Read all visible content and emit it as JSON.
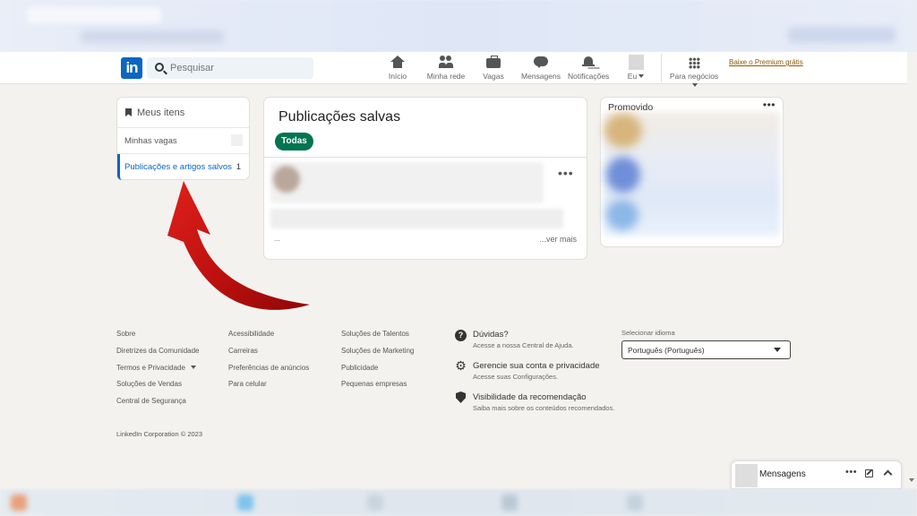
{
  "header": {
    "logo_text": "in",
    "search_placeholder": "Pesquisar",
    "nav": [
      {
        "label": "Início",
        "icon": "home-icon"
      },
      {
        "label": "Minha rede",
        "icon": "network-icon"
      },
      {
        "label": "Vagas",
        "icon": "jobs-icon"
      },
      {
        "label": "Mensagens",
        "icon": "messages-icon"
      },
      {
        "label": "Notificações",
        "icon": "bell-icon"
      },
      {
        "label": "Eu",
        "icon": "avatar"
      },
      {
        "label": "Para negócios",
        "icon": "grid-icon"
      }
    ],
    "premium_link": "Baixe o Premium grátis"
  },
  "left_panel": {
    "title": "Meus itens",
    "items": [
      {
        "label": "Minhas vagas",
        "count": ""
      },
      {
        "label": "Publicações e artigos salvos",
        "count": "1"
      }
    ]
  },
  "center": {
    "title": "Publicações salvas",
    "filter_pill": "Todas",
    "post_ellipsis": "...",
    "see_more": "...ver mais"
  },
  "promo": {
    "title": "Promovido"
  },
  "footer": {
    "col1": [
      "Sobre",
      "Diretrizes da Comunidade",
      "Termos e Privacidade",
      "Soluções de Vendas",
      "Central de Segurança"
    ],
    "col2": [
      "Acessibilidade",
      "Carreiras",
      "Preferências de anúncios",
      "Para celular"
    ],
    "col3": [
      "Soluções de Talentos",
      "Soluções de Marketing",
      "Publicidade",
      "Pequenas empresas"
    ],
    "help": [
      {
        "title": "Dúvidas?",
        "sub": "Acesse a nossa Central de Ajuda."
      },
      {
        "title": "Gerencie sua conta e privacidade",
        "sub": "Acesse suas Configurações."
      },
      {
        "title": "Visibilidade da recomendação",
        "sub": "Saiba mais sobre os conteúdos recomendados."
      }
    ],
    "language_label": "Selecionar idioma",
    "language_value": "Português (Português)",
    "copyright": "LinkedIn Corporation © 2023"
  },
  "messaging": {
    "title": "Mensagens"
  },
  "colors": {
    "brand": "#0a66c2",
    "pill": "#01754f",
    "arrow": "#c0110f",
    "premium": "#915907"
  }
}
